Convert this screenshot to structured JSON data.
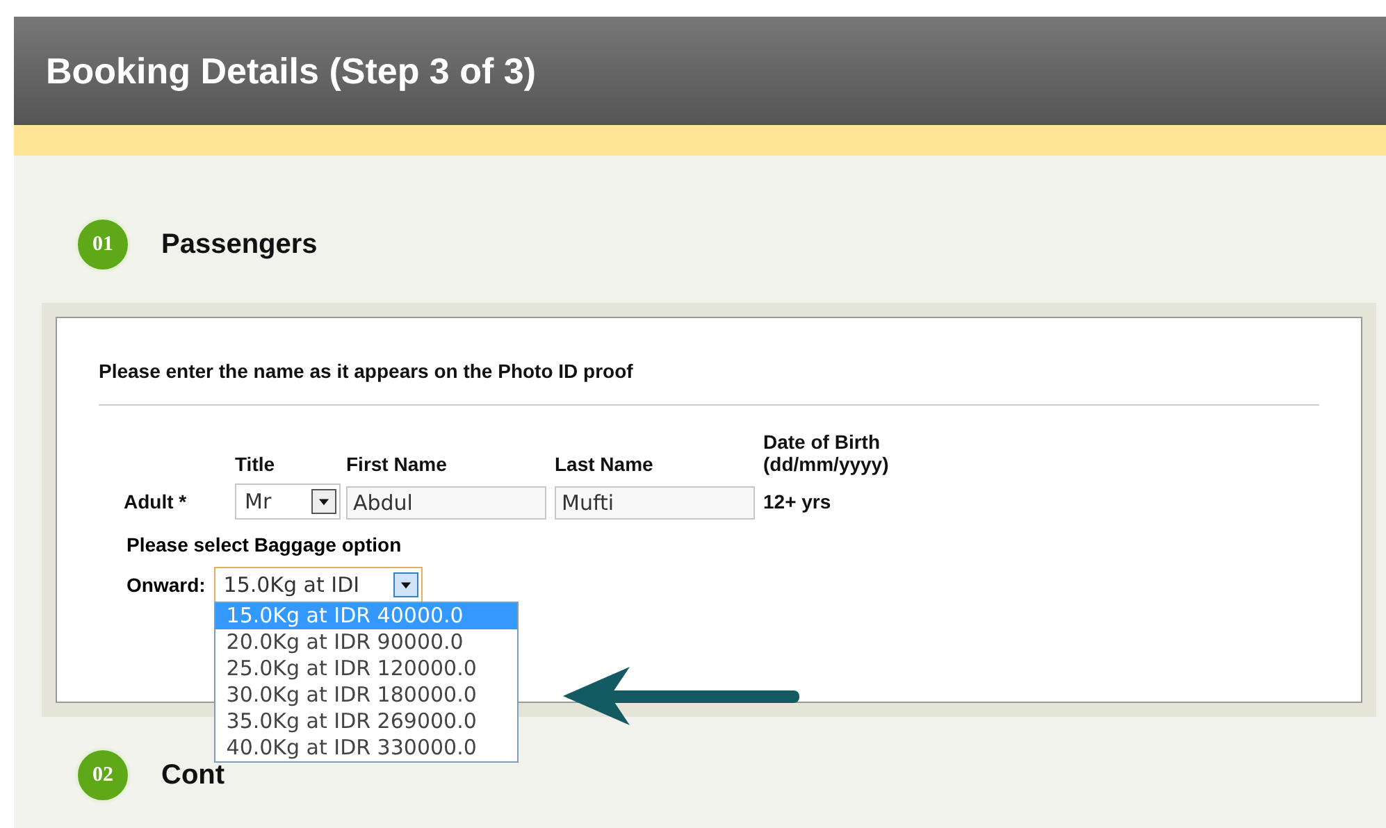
{
  "header": {
    "title": "Booking Details (Step 3 of 3)"
  },
  "sections": [
    {
      "number": "01",
      "title": "Passengers"
    },
    {
      "number": "02",
      "title": "Cont"
    }
  ],
  "passenger_form": {
    "instruction": "Please enter the name as it appears on the Photo ID proof",
    "columns": [
      "Title",
      "First Name",
      "Last Name",
      "Date of Birth\n(dd/mm/yyyy)"
    ],
    "row": {
      "label": "Adult *",
      "title": "Mr",
      "first_name": "Abdul",
      "last_name": "Mufti",
      "age": "12+ yrs"
    },
    "baggage": {
      "heading": "Please select Baggage option",
      "label": "Onward:",
      "value": "15.0Kg at IDI",
      "expanded": true,
      "options": [
        {
          "label": "15.0Kg at IDR 40000.0",
          "selected": true
        },
        {
          "label": "20.0Kg at IDR 90000.0",
          "selected": false
        },
        {
          "label": "25.0Kg at IDR 120000.0",
          "selected": false
        },
        {
          "label": "30.0Kg at IDR 180000.0",
          "selected": false
        },
        {
          "label": "35.0Kg at IDR 269000.0",
          "selected": false
        },
        {
          "label": "40.0Kg at IDR 330000.0",
          "selected": false
        }
      ]
    }
  }
}
